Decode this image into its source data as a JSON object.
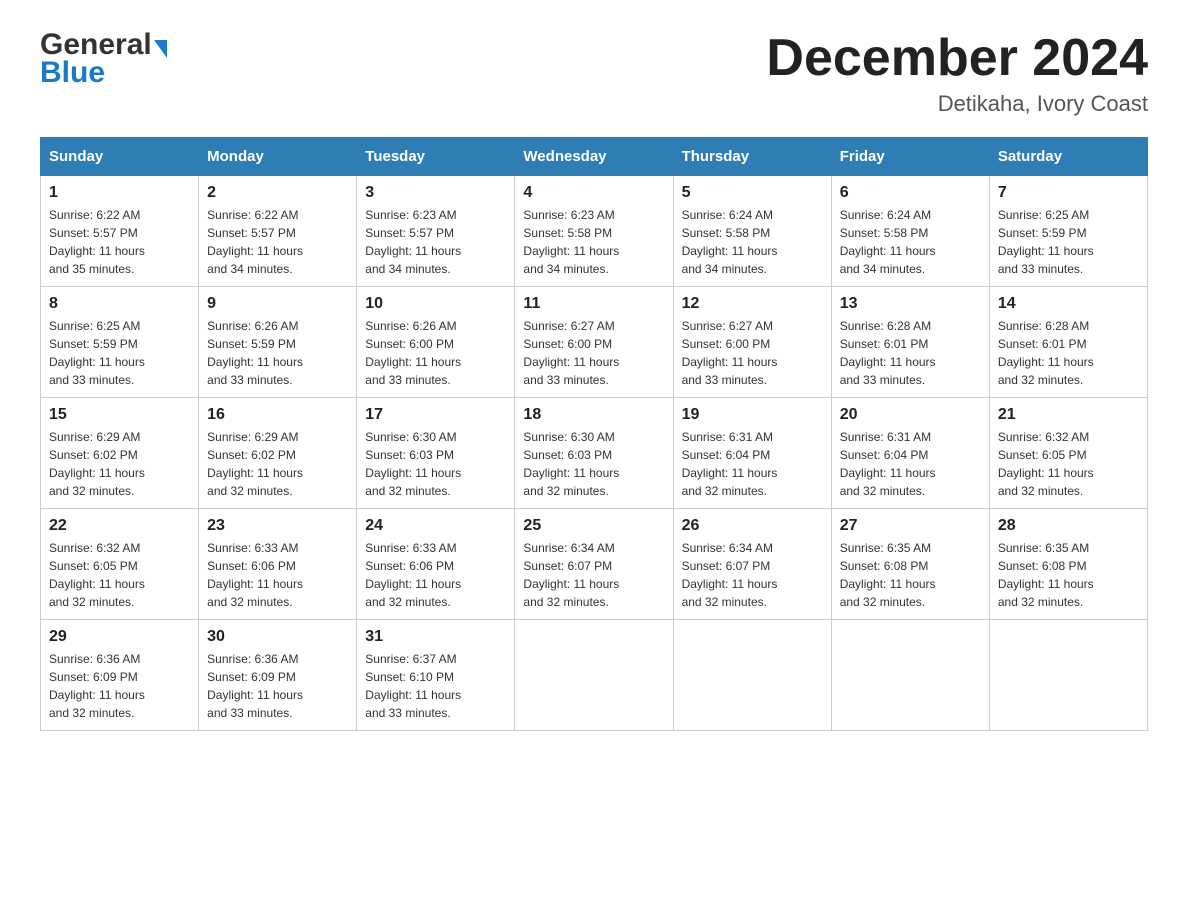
{
  "header": {
    "logo_general": "General",
    "logo_blue": "Blue",
    "month_title": "December 2024",
    "location": "Detikaha, Ivory Coast"
  },
  "weekdays": [
    "Sunday",
    "Monday",
    "Tuesday",
    "Wednesday",
    "Thursday",
    "Friday",
    "Saturday"
  ],
  "weeks": [
    [
      {
        "day": "1",
        "sunrise": "6:22 AM",
        "sunset": "5:57 PM",
        "daylight": "11 hours and 35 minutes."
      },
      {
        "day": "2",
        "sunrise": "6:22 AM",
        "sunset": "5:57 PM",
        "daylight": "11 hours and 34 minutes."
      },
      {
        "day": "3",
        "sunrise": "6:23 AM",
        "sunset": "5:57 PM",
        "daylight": "11 hours and 34 minutes."
      },
      {
        "day": "4",
        "sunrise": "6:23 AM",
        "sunset": "5:58 PM",
        "daylight": "11 hours and 34 minutes."
      },
      {
        "day": "5",
        "sunrise": "6:24 AM",
        "sunset": "5:58 PM",
        "daylight": "11 hours and 34 minutes."
      },
      {
        "day": "6",
        "sunrise": "6:24 AM",
        "sunset": "5:58 PM",
        "daylight": "11 hours and 34 minutes."
      },
      {
        "day": "7",
        "sunrise": "6:25 AM",
        "sunset": "5:59 PM",
        "daylight": "11 hours and 33 minutes."
      }
    ],
    [
      {
        "day": "8",
        "sunrise": "6:25 AM",
        "sunset": "5:59 PM",
        "daylight": "11 hours and 33 minutes."
      },
      {
        "day": "9",
        "sunrise": "6:26 AM",
        "sunset": "5:59 PM",
        "daylight": "11 hours and 33 minutes."
      },
      {
        "day": "10",
        "sunrise": "6:26 AM",
        "sunset": "6:00 PM",
        "daylight": "11 hours and 33 minutes."
      },
      {
        "day": "11",
        "sunrise": "6:27 AM",
        "sunset": "6:00 PM",
        "daylight": "11 hours and 33 minutes."
      },
      {
        "day": "12",
        "sunrise": "6:27 AM",
        "sunset": "6:00 PM",
        "daylight": "11 hours and 33 minutes."
      },
      {
        "day": "13",
        "sunrise": "6:28 AM",
        "sunset": "6:01 PM",
        "daylight": "11 hours and 33 minutes."
      },
      {
        "day": "14",
        "sunrise": "6:28 AM",
        "sunset": "6:01 PM",
        "daylight": "11 hours and 32 minutes."
      }
    ],
    [
      {
        "day": "15",
        "sunrise": "6:29 AM",
        "sunset": "6:02 PM",
        "daylight": "11 hours and 32 minutes."
      },
      {
        "day": "16",
        "sunrise": "6:29 AM",
        "sunset": "6:02 PM",
        "daylight": "11 hours and 32 minutes."
      },
      {
        "day": "17",
        "sunrise": "6:30 AM",
        "sunset": "6:03 PM",
        "daylight": "11 hours and 32 minutes."
      },
      {
        "day": "18",
        "sunrise": "6:30 AM",
        "sunset": "6:03 PM",
        "daylight": "11 hours and 32 minutes."
      },
      {
        "day": "19",
        "sunrise": "6:31 AM",
        "sunset": "6:04 PM",
        "daylight": "11 hours and 32 minutes."
      },
      {
        "day": "20",
        "sunrise": "6:31 AM",
        "sunset": "6:04 PM",
        "daylight": "11 hours and 32 minutes."
      },
      {
        "day": "21",
        "sunrise": "6:32 AM",
        "sunset": "6:05 PM",
        "daylight": "11 hours and 32 minutes."
      }
    ],
    [
      {
        "day": "22",
        "sunrise": "6:32 AM",
        "sunset": "6:05 PM",
        "daylight": "11 hours and 32 minutes."
      },
      {
        "day": "23",
        "sunrise": "6:33 AM",
        "sunset": "6:06 PM",
        "daylight": "11 hours and 32 minutes."
      },
      {
        "day": "24",
        "sunrise": "6:33 AM",
        "sunset": "6:06 PM",
        "daylight": "11 hours and 32 minutes."
      },
      {
        "day": "25",
        "sunrise": "6:34 AM",
        "sunset": "6:07 PM",
        "daylight": "11 hours and 32 minutes."
      },
      {
        "day": "26",
        "sunrise": "6:34 AM",
        "sunset": "6:07 PM",
        "daylight": "11 hours and 32 minutes."
      },
      {
        "day": "27",
        "sunrise": "6:35 AM",
        "sunset": "6:08 PM",
        "daylight": "11 hours and 32 minutes."
      },
      {
        "day": "28",
        "sunrise": "6:35 AM",
        "sunset": "6:08 PM",
        "daylight": "11 hours and 32 minutes."
      }
    ],
    [
      {
        "day": "29",
        "sunrise": "6:36 AM",
        "sunset": "6:09 PM",
        "daylight": "11 hours and 32 minutes."
      },
      {
        "day": "30",
        "sunrise": "6:36 AM",
        "sunset": "6:09 PM",
        "daylight": "11 hours and 33 minutes."
      },
      {
        "day": "31",
        "sunrise": "6:37 AM",
        "sunset": "6:10 PM",
        "daylight": "11 hours and 33 minutes."
      },
      null,
      null,
      null,
      null
    ]
  ],
  "labels": {
    "sunrise": "Sunrise:",
    "sunset": "Sunset:",
    "daylight": "Daylight:"
  }
}
